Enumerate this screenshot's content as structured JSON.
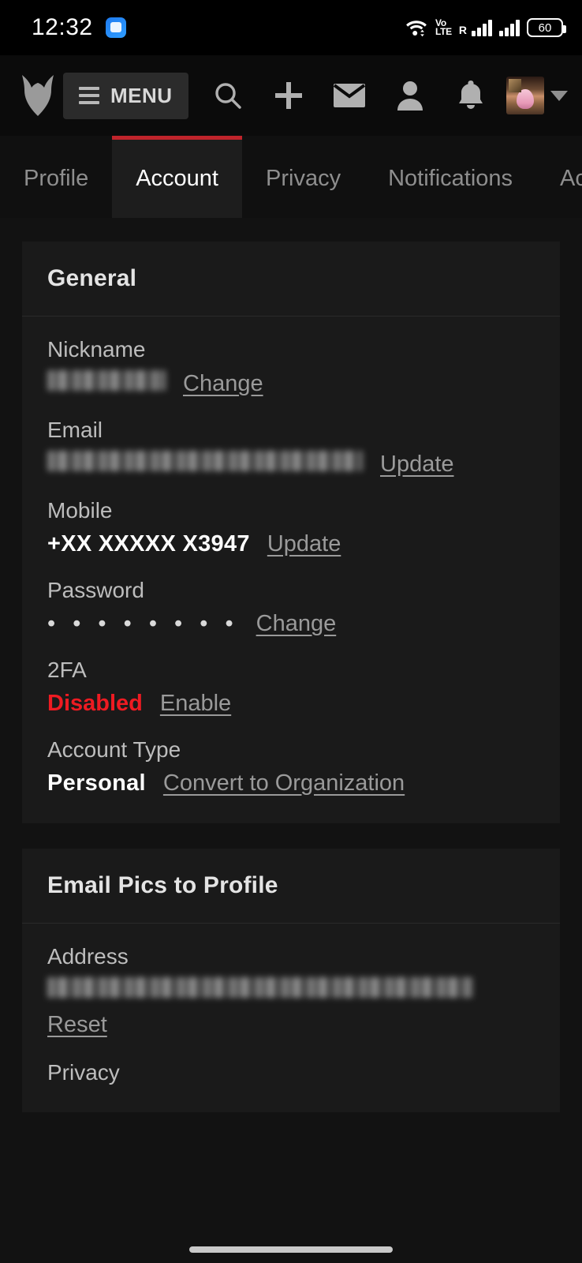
{
  "statusbar": {
    "clock": "12:32",
    "app_icon": "messages-icon",
    "wifi": "wifi-icon",
    "volte_top": "Vo",
    "volte_bottom": "LTE",
    "roaming": "R",
    "signal_1": "signal-bars-icon",
    "signal_2": "signal-bars-icon",
    "battery_level": "60"
  },
  "header": {
    "logo": "furaffinity-logo",
    "menu_label": "MENU",
    "icons": [
      {
        "name": "search-icon"
      },
      {
        "name": "plus-icon"
      },
      {
        "name": "envelope-icon"
      },
      {
        "name": "user-icon"
      },
      {
        "name": "bell-icon"
      }
    ],
    "avatar": "user-avatar",
    "caret": "chevron-down-icon"
  },
  "tabs": [
    {
      "label": "Profile",
      "active": false
    },
    {
      "label": "Account",
      "active": true
    },
    {
      "label": "Privacy",
      "active": false
    },
    {
      "label": "Notifications",
      "active": false
    },
    {
      "label": "Activi",
      "active": false
    }
  ],
  "general": {
    "title": "General",
    "nickname": {
      "label": "Nickname",
      "value": "",
      "action": "Change"
    },
    "email": {
      "label": "Email",
      "value": "",
      "action": "Update"
    },
    "mobile": {
      "label": "Mobile",
      "value": "+XX XXXXX X3947",
      "action": "Update"
    },
    "password": {
      "label": "Password",
      "value": "• • • • • • • •",
      "action": "Change"
    },
    "twofa": {
      "label": "2FA",
      "value": "Disabled",
      "action": "Enable"
    },
    "account_type": {
      "label": "Account Type",
      "value": "Personal",
      "action": "Convert to Organization"
    }
  },
  "email_pics": {
    "title": "Email Pics to Profile",
    "address": {
      "label": "Address",
      "value": "",
      "action": "Reset"
    }
  },
  "tail": {
    "privacy_label": "Privacy"
  },
  "colors": {
    "accent_red": "#c0242b",
    "danger_red": "#ee1b22",
    "page_bg": "#121212",
    "card_bg": "#1a1a1a",
    "link": "#9a9a9a"
  }
}
